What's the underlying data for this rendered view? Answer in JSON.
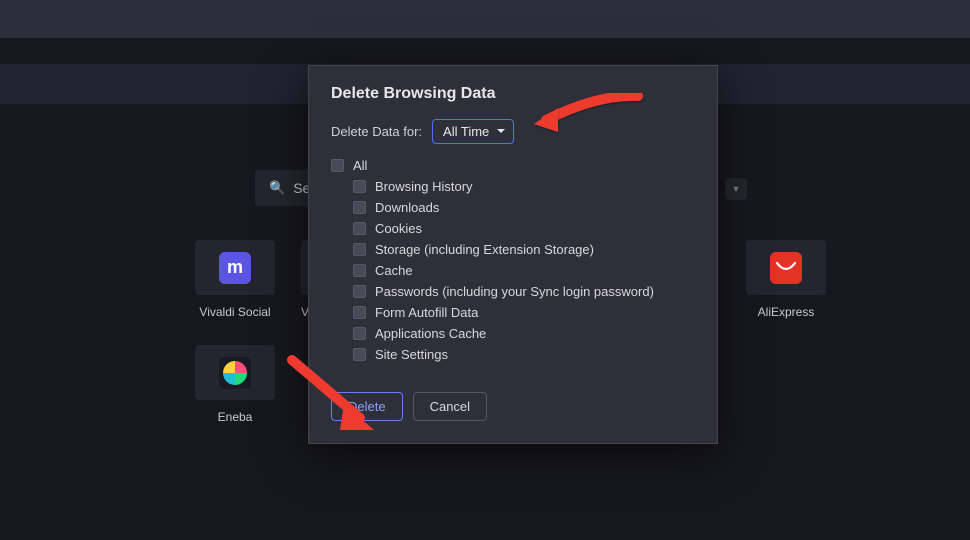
{
  "search": {
    "placeholder": "Sear"
  },
  "dials": {
    "vivaldi_social": {
      "label": "Vivaldi Social",
      "glyph": "m"
    },
    "eneba": {
      "label": "Eneba"
    },
    "aliexpress": {
      "label": "AliExpress",
      "glyph": "◡"
    },
    "partial_label": "V"
  },
  "dialog": {
    "title": "Delete Browsing Data",
    "time_label": "Delete Data for:",
    "time_selected": "All Time",
    "checkboxes": {
      "all": "All",
      "items": [
        "Browsing History",
        "Downloads",
        "Cookies",
        "Storage (including Extension Storage)",
        "Cache",
        "Passwords (including your Sync login password)",
        "Form Autofill Data",
        "Applications Cache",
        "Site Settings"
      ]
    },
    "buttons": {
      "delete": "Delete",
      "cancel": "Cancel"
    }
  }
}
